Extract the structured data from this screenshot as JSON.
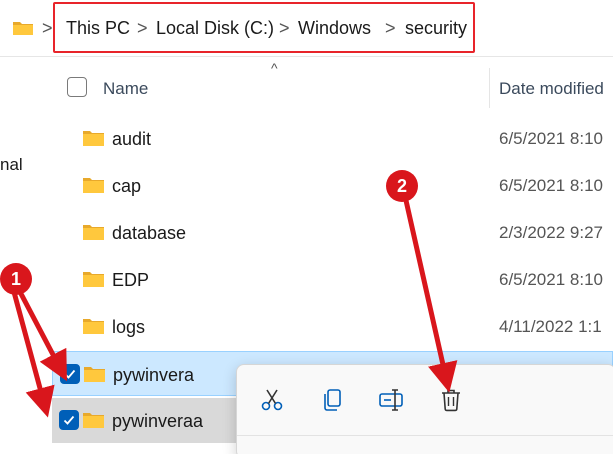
{
  "address": {
    "crumbs": [
      "This PC",
      "Local Disk (C:)",
      "Windows",
      "security"
    ],
    "separator": ">"
  },
  "nav": {
    "partial_label": "nal"
  },
  "columns": {
    "name": "Name",
    "date_modified": "Date modified",
    "sort_indicator": "^"
  },
  "files": [
    {
      "name": "audit",
      "date": "6/5/2021 8:10",
      "selected": false
    },
    {
      "name": "cap",
      "date": "6/5/2021 8:10",
      "selected": false
    },
    {
      "name": "database",
      "date": "2/3/2022 9:27",
      "selected": false
    },
    {
      "name": "EDP",
      "date": "6/5/2021 8:10",
      "selected": false
    },
    {
      "name": "logs",
      "date": "4/11/2022 1:1",
      "selected": false
    },
    {
      "name": "pywinvera",
      "date": "",
      "selected": true
    },
    {
      "name": "pywinveraa",
      "date": "",
      "selected": true
    }
  ],
  "context_menu": {
    "icons": [
      "cut-icon",
      "copy-icon",
      "rename-icon",
      "delete-icon"
    ]
  },
  "annotations": {
    "badge_1": "1",
    "badge_2": "2"
  },
  "colors": {
    "accent": "#005fb8",
    "selection": "#cce8ff",
    "annotation_red": "#d9161c",
    "folder_yellow": "#ffc83d"
  }
}
